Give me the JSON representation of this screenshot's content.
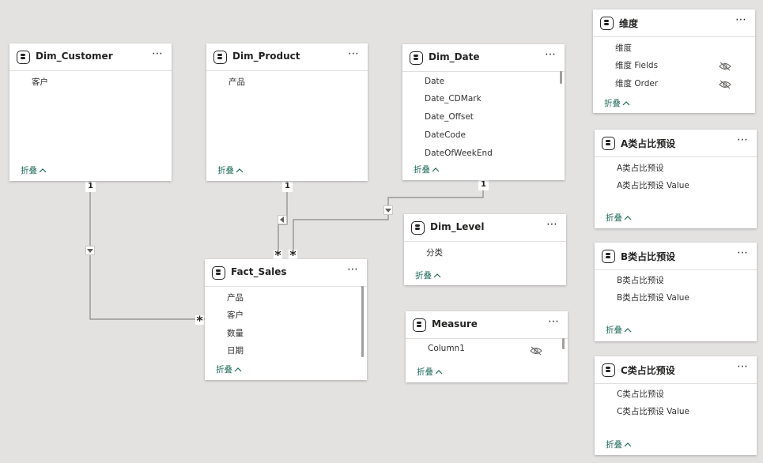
{
  "tables": {
    "dim_customer": {
      "title": "Dim_Customer",
      "more": "⋯",
      "fields": [
        "客户"
      ],
      "collapse": "折叠"
    },
    "dim_product": {
      "title": "Dim_Product",
      "more": "⋯",
      "fields": [
        "产品"
      ],
      "collapse": "折叠"
    },
    "dim_date": {
      "title": "Dim_Date",
      "more": "⋯",
      "fields": [
        "Date",
        "Date_CDMark",
        "Date_Offset",
        "DateCode",
        "DateOfWeekEnd"
      ],
      "collapse": "折叠"
    },
    "dim_level": {
      "title": "Dim_Level",
      "more": "⋯",
      "fields": [
        "分类"
      ],
      "collapse": "折叠"
    },
    "fact_sales": {
      "title": "Fact_Sales",
      "more": "⋯",
      "fields": [
        "产品",
        "客户",
        "数量",
        "日期"
      ],
      "collapse": "折叠"
    },
    "measure": {
      "title": "Measure",
      "more": "⋯",
      "fields": [
        "Column1"
      ],
      "collapse": "折叠"
    },
    "weidu": {
      "title": "维度",
      "more": "⋯",
      "fields": [
        "维度",
        "维度 Fields",
        "维度 Order"
      ],
      "collapse": "折叠"
    },
    "a_preset": {
      "title": "A类占比预设",
      "more": "⋯",
      "fields": [
        "A类占比预设",
        "A类占比预设 Value"
      ],
      "collapse": "折叠"
    },
    "b_preset": {
      "title": "B类占比预设",
      "more": "⋯",
      "fields": [
        "B类占比预设",
        "B类占比预设 Value"
      ],
      "collapse": "折叠"
    },
    "c_preset": {
      "title": "C类占比预设",
      "more": "⋯",
      "fields": [
        "C类占比预设",
        "C类占比预设 Value"
      ],
      "collapse": "折叠"
    }
  },
  "relationships": {
    "one": "1",
    "many": "*"
  },
  "icons": {
    "table": "table-icon",
    "hidden": "eye-hidden-icon",
    "collapse": "chevron-up-icon"
  },
  "colors": {
    "canvas": "#e3e2e1",
    "card": "#ffffff",
    "collapse_link": "#1f6b5a",
    "line": "#8a8886"
  }
}
